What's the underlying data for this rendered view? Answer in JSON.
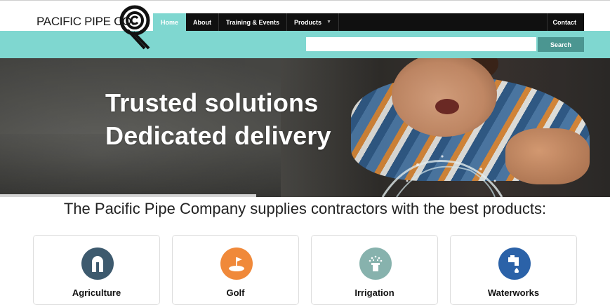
{
  "brand": {
    "name": "PACIFIC PIPE CO."
  },
  "nav": {
    "items": [
      {
        "label": "Home",
        "active": true
      },
      {
        "label": "About"
      },
      {
        "label": "Training & Events"
      },
      {
        "label": "Products",
        "has_caret": true
      }
    ],
    "contact_label": "Contact"
  },
  "search": {
    "value": "",
    "placeholder": "",
    "button_label": "Search"
  },
  "hero": {
    "line1": "Trusted solutions",
    "line2": "Dedicated delivery",
    "slide_progress": 0.42
  },
  "tagline": "The Pacific Pipe Company supplies contractors with the best products:",
  "categories": [
    {
      "label": "Agriculture",
      "icon": "silo-icon",
      "color": "#3d5a6e"
    },
    {
      "label": "Golf",
      "icon": "golf-flag-icon",
      "color": "#f0893a"
    },
    {
      "label": "Irrigation",
      "icon": "sprinkler-icon",
      "color": "#87b2ad"
    },
    {
      "label": "Waterworks",
      "icon": "faucet-icon",
      "color": "#2b62a8"
    }
  ],
  "colors": {
    "accent": "#7fd7d0",
    "nav_bg": "#101010",
    "search_button": "#4b9691"
  }
}
